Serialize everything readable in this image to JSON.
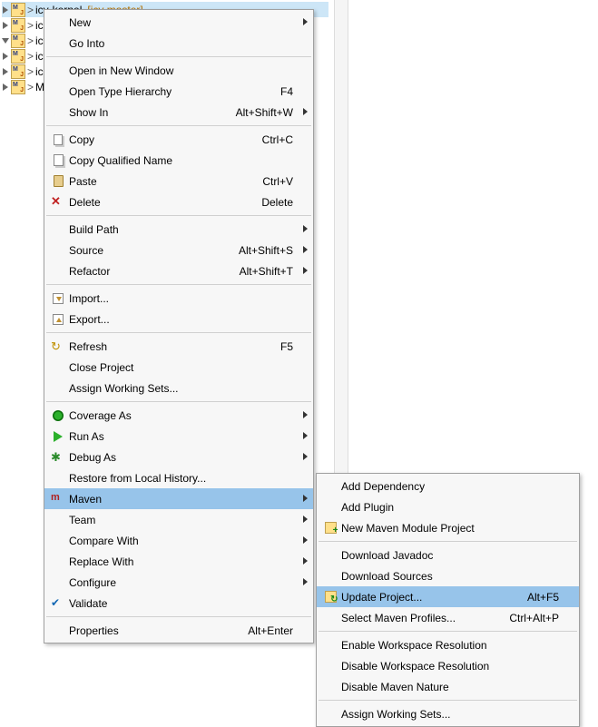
{
  "tree": {
    "items": [
      {
        "label": "icy-kernel",
        "branch": "[icy master]",
        "selected": true,
        "expandable": true
      },
      {
        "label": "ic",
        "expandable": true
      },
      {
        "label": "icy",
        "expandable": false
      },
      {
        "label": "icy",
        "expandable": true
      },
      {
        "label": "ic",
        "expandable": true
      },
      {
        "label": "My",
        "expandable": true
      }
    ]
  },
  "menu": {
    "groups": [
      [
        {
          "label": "New",
          "submenu": true
        },
        {
          "label": "Go Into"
        }
      ],
      [
        {
          "label": "Open in New Window"
        },
        {
          "label": "Open Type Hierarchy",
          "shortcut": "F4"
        },
        {
          "label": "Show In",
          "shortcut": "Alt+Shift+W",
          "submenu": true
        }
      ],
      [
        {
          "label": "Copy",
          "shortcut": "Ctrl+C",
          "icon": "copy"
        },
        {
          "label": "Copy Qualified Name",
          "icon": "copyq"
        },
        {
          "label": "Paste",
          "shortcut": "Ctrl+V",
          "icon": "paste"
        },
        {
          "label": "Delete",
          "shortcut": "Delete",
          "icon": "delete"
        }
      ],
      [
        {
          "label": "Build Path",
          "submenu": true
        },
        {
          "label": "Source",
          "shortcut": "Alt+Shift+S",
          "submenu": true
        },
        {
          "label": "Refactor",
          "shortcut": "Alt+Shift+T",
          "submenu": true
        }
      ],
      [
        {
          "label": "Import...",
          "icon": "import"
        },
        {
          "label": "Export...",
          "icon": "export"
        }
      ],
      [
        {
          "label": "Refresh",
          "shortcut": "F5",
          "icon": "refresh"
        },
        {
          "label": "Close Project"
        },
        {
          "label": "Assign Working Sets..."
        }
      ],
      [
        {
          "label": "Coverage As",
          "submenu": true,
          "icon": "coverage"
        },
        {
          "label": "Run As",
          "submenu": true,
          "icon": "run"
        },
        {
          "label": "Debug As",
          "submenu": true,
          "icon": "debug"
        },
        {
          "label": "Restore from Local History..."
        },
        {
          "label": "Maven",
          "submenu": true,
          "icon": "maven",
          "highlight": true
        },
        {
          "label": "Team",
          "submenu": true
        },
        {
          "label": "Compare With",
          "submenu": true
        },
        {
          "label": "Replace With",
          "submenu": true
        },
        {
          "label": "Configure",
          "submenu": true
        },
        {
          "label": "Validate",
          "icon": "check"
        }
      ],
      [
        {
          "label": "Properties",
          "shortcut": "Alt+Enter"
        }
      ]
    ]
  },
  "submenu": {
    "groups": [
      [
        {
          "label": "Add Dependency"
        },
        {
          "label": "Add Plugin"
        },
        {
          "label": "New Maven Module Project",
          "icon": "newmaven"
        }
      ],
      [
        {
          "label": "Download Javadoc"
        },
        {
          "label": "Download Sources"
        },
        {
          "label": "Update Project...",
          "shortcut": "Alt+F5",
          "icon": "update",
          "highlight": true
        },
        {
          "label": "Select Maven Profiles...",
          "shortcut": "Ctrl+Alt+P"
        }
      ],
      [
        {
          "label": "Enable Workspace Resolution"
        },
        {
          "label": "Disable Workspace Resolution"
        },
        {
          "label": "Disable Maven Nature"
        }
      ],
      [
        {
          "label": "Assign Working Sets..."
        }
      ]
    ]
  }
}
